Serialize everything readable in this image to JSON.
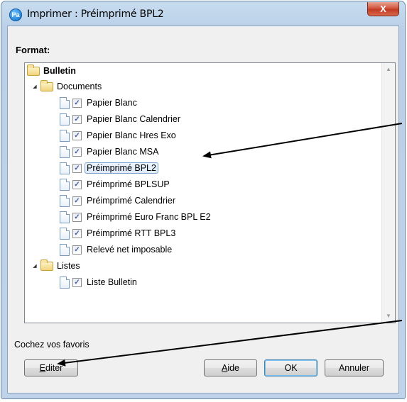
{
  "window": {
    "app_icon_text": "Pa",
    "title": "Imprimer : Préimprimé BPL2",
    "close_symbol": "X"
  },
  "format_label": "Format:",
  "tree": {
    "root": "Bulletin",
    "documents_folder": "Documents",
    "documents": [
      "Papier Blanc",
      "Papier Blanc Calendrier",
      "Papier Blanc Hres Exo",
      "Papier Blanc MSA",
      "Préimprimé BPL2",
      "Préimprimé BPLSUP",
      "Préimprimé Calendrier",
      "Préimprimé Euro Franc BPL E2",
      "Préimprimé RTT BPL3",
      "Relevé net imposable"
    ],
    "selected_document": "Préimprimé BPL2",
    "listes_folder": "Listes",
    "listes": [
      "Liste Bulletin"
    ]
  },
  "hint": "Cochez vos favoris",
  "buttons": {
    "editer_first": "E",
    "editer_rest": "diter",
    "aide_first": "A",
    "aide_rest": "ide",
    "ok": "OK",
    "annuler": "Annuler"
  }
}
